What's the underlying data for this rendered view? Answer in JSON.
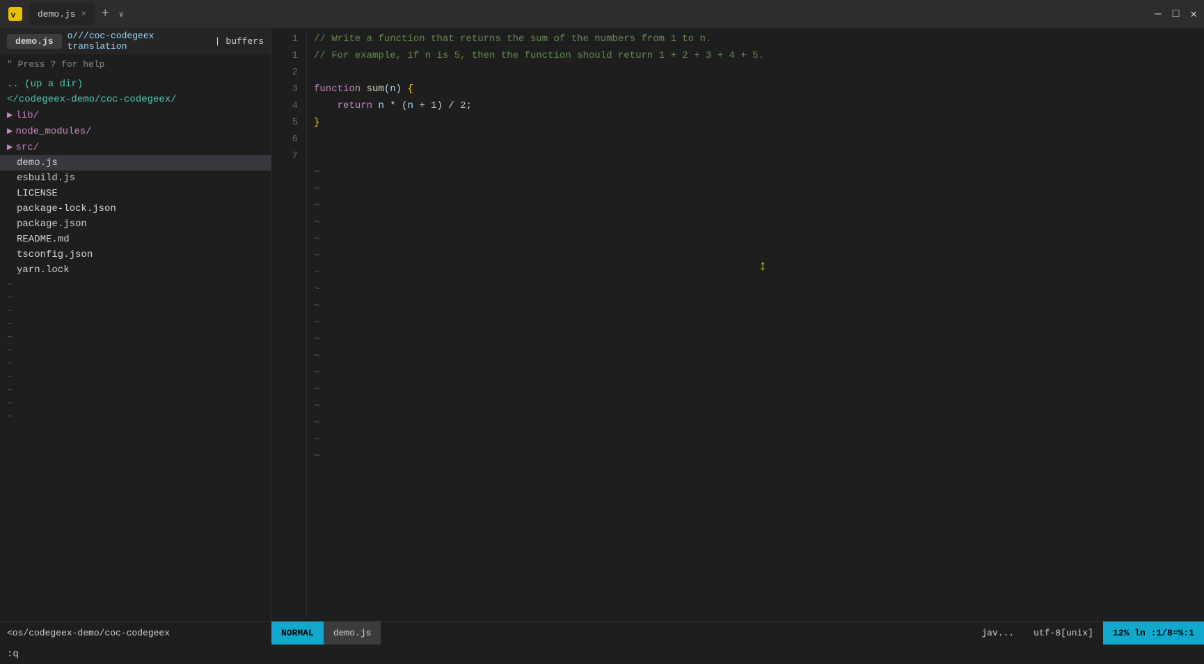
{
  "titlebar": {
    "title": "vim",
    "tab_label": "demo.js",
    "close_label": "×",
    "new_tab": "+",
    "dropdown": "∨"
  },
  "window_controls": {
    "minimize": "—",
    "maximize": "□",
    "close": "✕"
  },
  "sidebar": {
    "file_tab": "demo.js",
    "header_path": "o///coc-codegeex translation",
    "cursor": "|",
    "buffers_label": "buffers",
    "hint": "\" Press ? for help",
    "tree": [
      {
        "type": "up-dir",
        "label": ".. (up a dir)"
      },
      {
        "type": "dir",
        "label": "</codegeex-demo/coc-codegeex/"
      },
      {
        "type": "dir-item",
        "label": "lib/",
        "arrow": "▶"
      },
      {
        "type": "dir-item",
        "label": "node_modules/",
        "arrow": "▶"
      },
      {
        "type": "dir-item",
        "label": "src/",
        "arrow": "▶"
      },
      {
        "type": "file",
        "label": "demo.js",
        "selected": true
      },
      {
        "type": "file",
        "label": "esbuild.js"
      },
      {
        "type": "file",
        "label": "LICENSE"
      },
      {
        "type": "file",
        "label": "package-lock.json"
      },
      {
        "type": "file",
        "label": "package.json"
      },
      {
        "type": "file",
        "label": "README.md"
      },
      {
        "type": "file",
        "label": "tsconfig.json"
      },
      {
        "type": "file",
        "label": "yarn.lock"
      }
    ]
  },
  "editor": {
    "lines": [
      {
        "num": 1,
        "content": "comment",
        "text": "// Write a function that returns the sum of the numbers from 1 to n."
      },
      {
        "num": 1,
        "content": "comment",
        "text": "// For example, if n is 5, then the function should return 1 + 2 + 3 + 4 + 5."
      },
      {
        "num": 2,
        "content": "empty",
        "text": ""
      },
      {
        "num": 3,
        "content": "function",
        "text": "function sum(n) {"
      },
      {
        "num": 4,
        "content": "return",
        "text": "    return n * (n + 1) / 2;"
      },
      {
        "num": 5,
        "content": "brace",
        "text": "}"
      },
      {
        "num": 6,
        "content": "empty",
        "text": ""
      },
      {
        "num": 7,
        "content": "empty",
        "text": ""
      }
    ]
  },
  "statusbar": {
    "left_path": "<os/codegeex-demo/coc-codegeex",
    "mode": "NORMAL",
    "filename": "demo.js",
    "filetype": "jav...",
    "encoding": "utf-8[unix]",
    "position": "12%  ln :1/8=%:1"
  },
  "command_line": {
    "text": ":q"
  }
}
